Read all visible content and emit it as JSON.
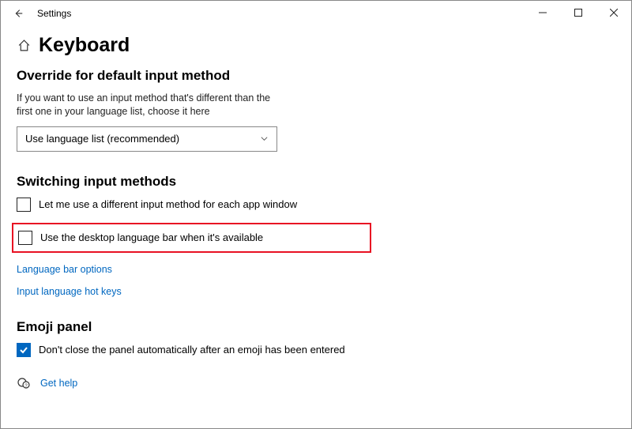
{
  "window": {
    "title": "Settings"
  },
  "page": {
    "heading": "Keyboard"
  },
  "override": {
    "title": "Override for default input method",
    "desc": "If you want to use an input method that's different than the first one in your language list, choose it here",
    "dropdown_value": "Use language list (recommended)"
  },
  "switching": {
    "title": "Switching input methods",
    "checkbox1_label": "Let me use a different input method for each app window",
    "checkbox2_label": "Use the desktop language bar when it's available",
    "link1": "Language bar options",
    "link2": "Input language hot keys"
  },
  "emoji": {
    "title": "Emoji panel",
    "checkbox_label": "Don't close the panel automatically after an emoji has been entered"
  },
  "help": {
    "label": "Get help"
  }
}
